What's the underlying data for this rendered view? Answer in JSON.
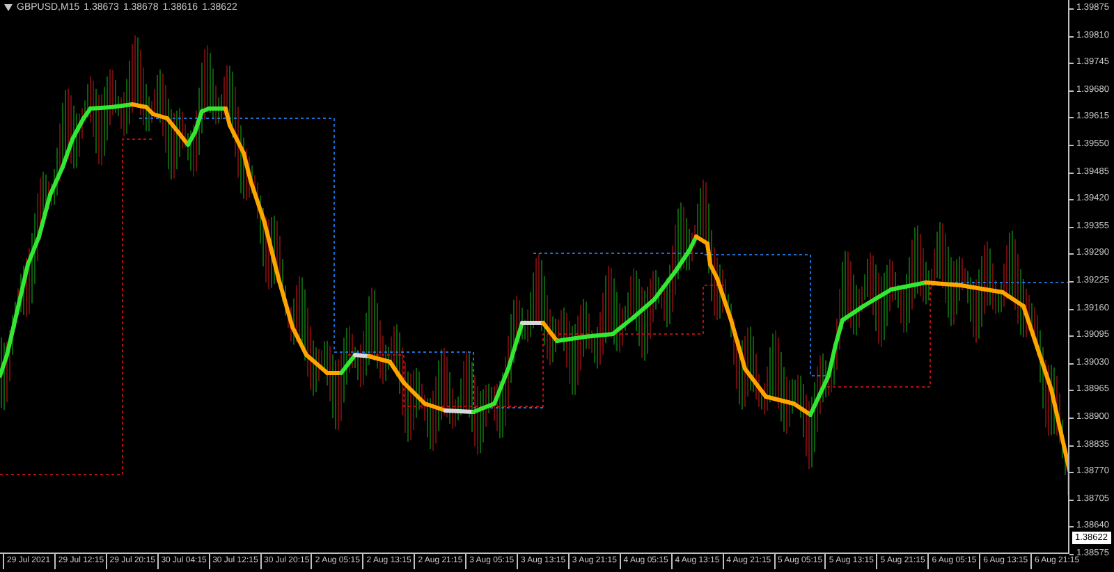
{
  "chart": {
    "symbol": "GBPUSD,M15",
    "quotes": [
      "1.38673",
      "1.38678",
      "1.38616",
      "1.38622"
    ]
  },
  "price_axis": {
    "labels": [
      "1.39875",
      "1.39810",
      "1.39745",
      "1.39680",
      "1.39615",
      "1.39550",
      "1.39485",
      "1.39420",
      "1.39355",
      "1.39290",
      "1.39225",
      "1.39160",
      "1.39095",
      "1.39030",
      "1.38965",
      "1.38900",
      "1.38835",
      "1.38770",
      "1.38705",
      "1.38640",
      "1.38575"
    ],
    "current_price": "1.38622"
  },
  "time_axis": {
    "labels": [
      "29 Jul 2021",
      "29 Jul 12:15",
      "29 Jul 20:15",
      "30 Jul 04:15",
      "30 Jul 12:15",
      "30 Jul 20:15",
      "2 Aug 05:15",
      "2 Aug 13:15",
      "2 Aug 21:15",
      "3 Aug 05:15",
      "3 Aug 13:15",
      "3 Aug 21:15",
      "4 Aug 05:15",
      "4 Aug 13:15",
      "4 Aug 21:15",
      "5 Aug 05:15",
      "5 Aug 13:15",
      "5 Aug 21:15",
      "6 Aug 05:15",
      "6 Aug 13:15",
      "6 Aug 21:15"
    ]
  }
}
